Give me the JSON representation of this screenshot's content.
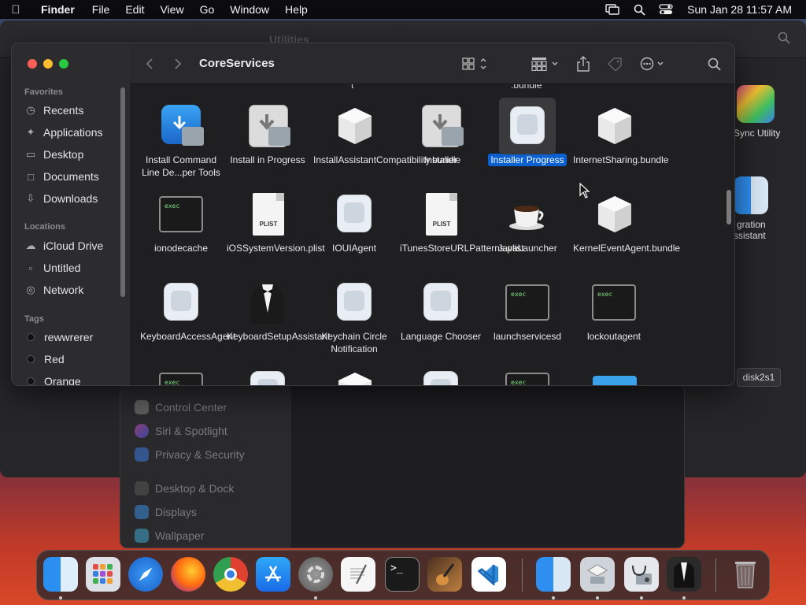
{
  "menubar": {
    "app_name": "Finder",
    "items": [
      "File",
      "Edit",
      "View",
      "Go",
      "Window",
      "Help"
    ],
    "clock": "Sun Jan 28  11:57 AM"
  },
  "background_window": {
    "title": "Utilities"
  },
  "right_apps": {
    "sync_utility": "Sync Utility",
    "migration_line1": "gration",
    "migration_line2": "ssistant",
    "disk_label": "disk2s1"
  },
  "settings_sidebar": {
    "items": [
      "Control Center",
      "Siri & Spotlight",
      "Privacy & Security",
      "Desktop & Dock",
      "Displays",
      "Wallpaper"
    ]
  },
  "finder": {
    "title": "CoreServices",
    "sidebar": {
      "favorites_header": "Favorites",
      "favorites": [
        "Recents",
        "Applications",
        "Desktop",
        "Documents",
        "Downloads"
      ],
      "locations_header": "Locations",
      "locations": [
        "iCloud Drive",
        "Untitled",
        "Network"
      ],
      "tags_header": "Tags",
      "tags": [
        "rewwrerer",
        "Red",
        "Orange"
      ]
    },
    "top_partial": {
      "col3": "t",
      "col5": ".bundle"
    },
    "rows": [
      [
        {
          "name": "Install Command Line De...per Tools",
          "icon": "command-line-tools-icon"
        },
        {
          "name": "Install in Progress",
          "icon": "installer-icon"
        },
        {
          "name": "InstallAssistantCompatibility.bundle",
          "icon": "bundle-cube-icon"
        },
        {
          "name": "Installer",
          "icon": "installer-icon"
        },
        {
          "name": "Installer Progress",
          "icon": "generic-app-icon",
          "selected": true
        },
        {
          "name": "InternetSharing.bundle",
          "icon": "bundle-cube-icon"
        }
      ],
      [
        {
          "name": "ionodecache",
          "icon": "exec-icon"
        },
        {
          "name": "iOSSystemVersion.plist",
          "icon": "plist-icon"
        },
        {
          "name": "IOUIAgent",
          "icon": "generic-app-icon"
        },
        {
          "name": "iTunesStoreURLPatterns.plist",
          "icon": "plist-icon"
        },
        {
          "name": "JavaLauncher",
          "icon": "coffee-cup-icon"
        },
        {
          "name": "KernelEventAgent.bundle",
          "icon": "bundle-cube-icon"
        }
      ],
      [
        {
          "name": "KeyboardAccessAgent",
          "icon": "generic-app-icon"
        },
        {
          "name": "KeyboardSetupAssistant",
          "icon": "tuxedo-icon"
        },
        {
          "name": "Keychain Circle Notification",
          "icon": "generic-app-icon"
        },
        {
          "name": "Language Chooser",
          "icon": "generic-app-icon"
        },
        {
          "name": "launchservicesd",
          "icon": "exec-icon"
        },
        {
          "name": "lockoutagent",
          "icon": "exec-icon"
        }
      ]
    ],
    "exec_label": "exec",
    "plist_label": "PLIST"
  },
  "dock": {
    "apps": [
      "finder-icon",
      "launchpad-icon",
      "safari-icon",
      "firefox-icon",
      "chrome-icon",
      "app-store-icon",
      "system-settings-icon",
      "textedit-icon",
      "terminal-icon",
      "garageband-icon",
      "vscode-icon",
      "migration-assistant-icon",
      "boot-camp-icon",
      "disk-utility-icon",
      "keyboard-setup-icon",
      "trash-icon"
    ],
    "terminal_glyph": ">_"
  }
}
